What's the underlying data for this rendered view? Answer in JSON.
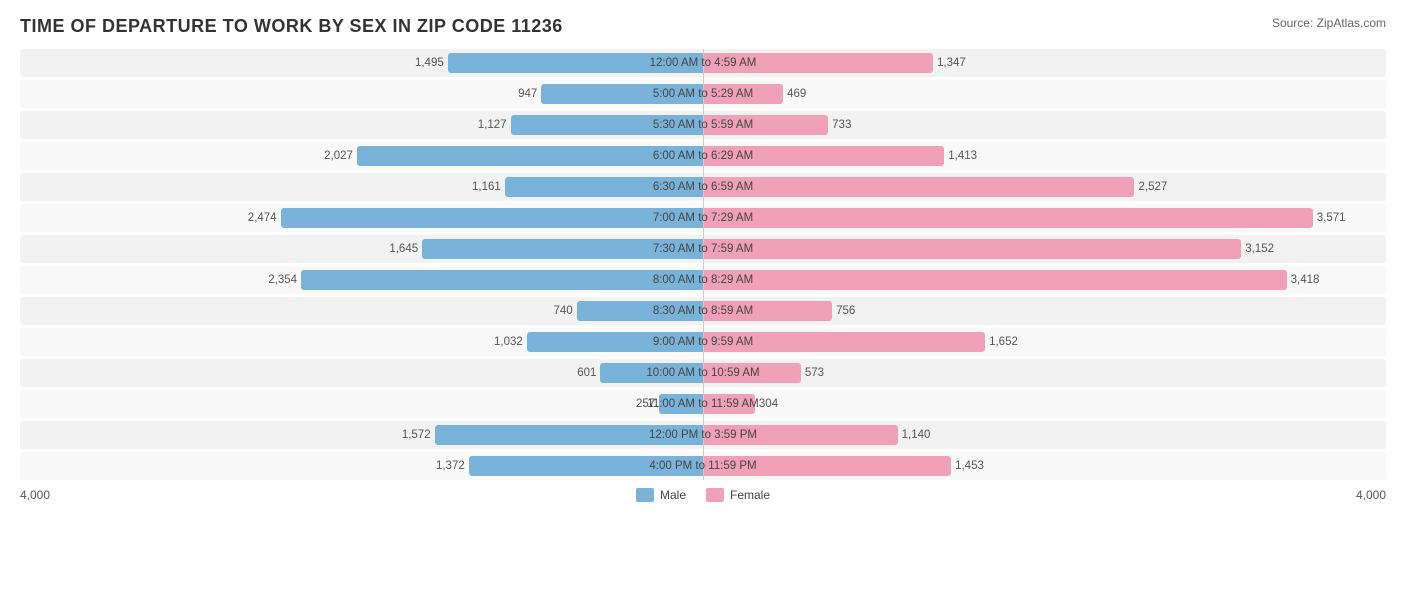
{
  "title": "TIME OF DEPARTURE TO WORK BY SEX IN ZIP CODE 11236",
  "source": "Source: ZipAtlas.com",
  "max_value": 4000,
  "colors": {
    "male": "#7ab3d9",
    "female": "#f0a0b8"
  },
  "legend": {
    "male_label": "Male",
    "female_label": "Female"
  },
  "axis": {
    "left": "4,000",
    "right": "4,000"
  },
  "rows": [
    {
      "time": "12:00 AM to 4:59 AM",
      "male": 1495,
      "female": 1347
    },
    {
      "time": "5:00 AM to 5:29 AM",
      "male": 947,
      "female": 469
    },
    {
      "time": "5:30 AM to 5:59 AM",
      "male": 1127,
      "female": 733
    },
    {
      "time": "6:00 AM to 6:29 AM",
      "male": 2027,
      "female": 1413
    },
    {
      "time": "6:30 AM to 6:59 AM",
      "male": 1161,
      "female": 2527
    },
    {
      "time": "7:00 AM to 7:29 AM",
      "male": 2474,
      "female": 3571
    },
    {
      "time": "7:30 AM to 7:59 AM",
      "male": 1645,
      "female": 3152
    },
    {
      "time": "8:00 AM to 8:29 AM",
      "male": 2354,
      "female": 3418
    },
    {
      "time": "8:30 AM to 8:59 AM",
      "male": 740,
      "female": 756
    },
    {
      "time": "9:00 AM to 9:59 AM",
      "male": 1032,
      "female": 1652
    },
    {
      "time": "10:00 AM to 10:59 AM",
      "male": 601,
      "female": 573
    },
    {
      "time": "11:00 AM to 11:59 AM",
      "male": 257,
      "female": 304
    },
    {
      "time": "12:00 PM to 3:59 PM",
      "male": 1572,
      "female": 1140
    },
    {
      "time": "4:00 PM to 11:59 PM",
      "male": 1372,
      "female": 1453
    }
  ]
}
